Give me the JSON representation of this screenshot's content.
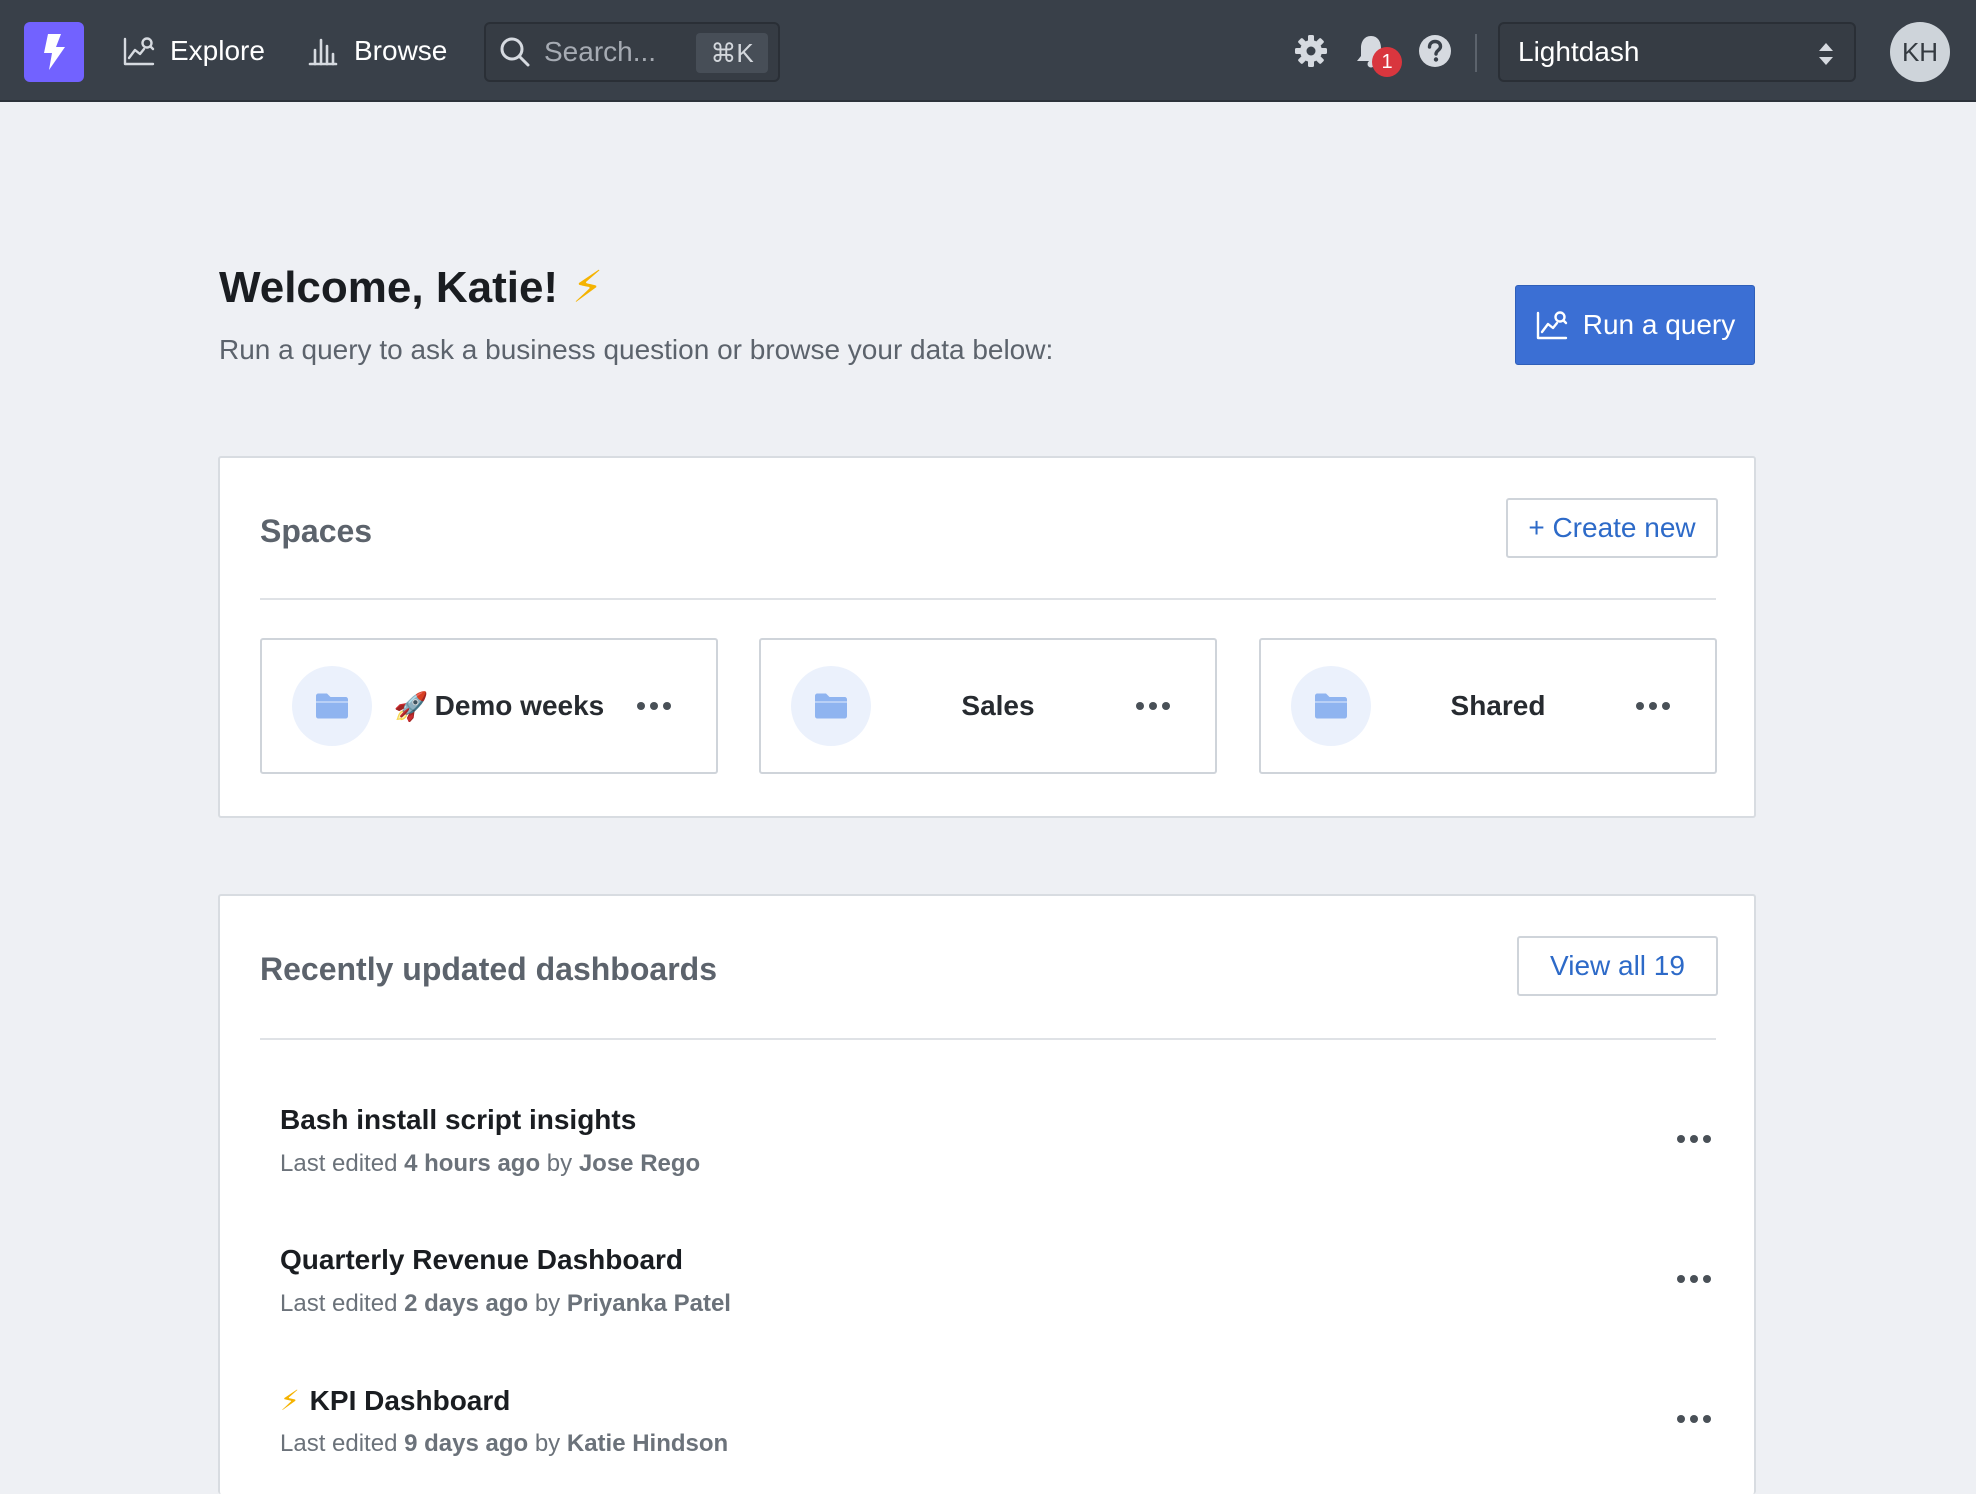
{
  "nav": {
    "explore_label": "Explore",
    "browse_label": "Browse",
    "search_placeholder": "Search...",
    "search_shortcut": "⌘K",
    "notification_count": "1",
    "project_name": "Lightdash",
    "user_initials": "KH"
  },
  "welcome": {
    "title": "Welcome, Katie!",
    "emoji": "⚡",
    "subtitle": "Run a query to ask a business question or browse your data below:",
    "run_query_label": "Run a query"
  },
  "spaces": {
    "title": "Spaces",
    "create_label": "+ Create new",
    "items": [
      {
        "emoji": "🚀",
        "name": "Demo weeks"
      },
      {
        "emoji": "",
        "name": "Sales"
      },
      {
        "emoji": "",
        "name": "Shared"
      }
    ]
  },
  "dashboards": {
    "title": "Recently updated dashboards",
    "view_all_label": "View all 19",
    "items": [
      {
        "emoji": "",
        "name": "Bash install script insights",
        "prefix": "Last edited",
        "time": "4 hours ago",
        "by": "by",
        "author": "Jose Rego"
      },
      {
        "emoji": "",
        "name": "Quarterly Revenue Dashboard",
        "prefix": "Last edited",
        "time": "2 days ago",
        "by": "by",
        "author": "Priyanka Patel"
      },
      {
        "emoji": "⚡",
        "name": "KPI Dashboard",
        "prefix": "Last edited",
        "time": "9 days ago",
        "by": "by",
        "author": "Katie Hindson"
      }
    ]
  },
  "colors": {
    "navbar": "#394049",
    "brand": "#7262ff",
    "primary": "#3b6fd4",
    "badge": "#d9363e",
    "folder_icon": "#8fb4f0"
  }
}
